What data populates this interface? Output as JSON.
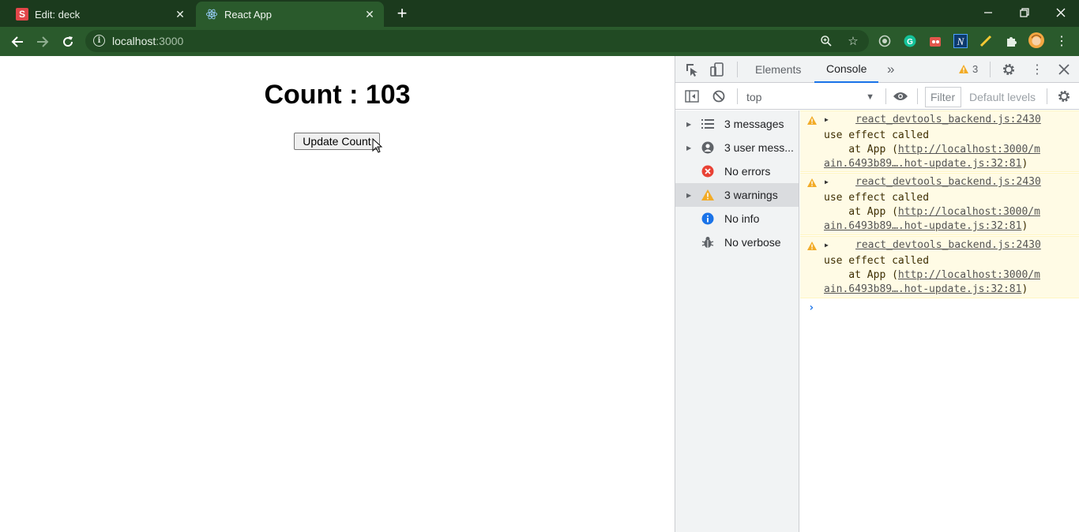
{
  "browser": {
    "tabs": [
      {
        "title": "Edit: deck",
        "favicon": "S"
      },
      {
        "title": "React App",
        "favicon": "react-icon"
      }
    ],
    "new_tab_label": "+",
    "url_host": "localhost",
    "url_port": ":3000",
    "window_controls": [
      "minimize-icon",
      "restore-icon",
      "close-icon"
    ]
  },
  "page": {
    "heading": "Count : 103",
    "button_label": "Update Count"
  },
  "devtools": {
    "tabs": [
      {
        "label": "Elements"
      },
      {
        "label": "Console"
      }
    ],
    "more_tabs": "»",
    "warning_count": "3",
    "context": "top",
    "filter_placeholder": "Filter",
    "levels_label": "Default levels",
    "sidebar": [
      {
        "label": "3 messages",
        "icon": "list-icon",
        "expandable": true
      },
      {
        "label": "3 user mess...",
        "icon": "user-icon",
        "expandable": true
      },
      {
        "label": "No errors",
        "icon": "error-icon",
        "expandable": false
      },
      {
        "label": "3 warnings",
        "icon": "warning-icon",
        "expandable": true,
        "selected": true
      },
      {
        "label": "No info",
        "icon": "info-icon",
        "expandable": false
      },
      {
        "label": "No verbose",
        "icon": "bug-icon",
        "expandable": false
      }
    ],
    "messages": [
      {
        "source": "react_devtools_backend.js:2430",
        "text": "use effect called",
        "at_prefix": "    at App (",
        "link_part1": "http://localhost:3000/m",
        "link_part2": "ain.6493b89….hot-update.js:32:81",
        "suffix": ")"
      },
      {
        "source": "react_devtools_backend.js:2430",
        "text": "use effect called",
        "at_prefix": "    at App (",
        "link_part1": "http://localhost:3000/m",
        "link_part2": "ain.6493b89….hot-update.js:32:81",
        "suffix": ")"
      },
      {
        "source": "react_devtools_backend.js:2430",
        "text": "use effect called",
        "at_prefix": "    at App (",
        "link_part1": "http://localhost:3000/m",
        "link_part2": "ain.6493b89….hot-update.js:32:81",
        "suffix": ")"
      }
    ],
    "prompt_symbol": "›"
  },
  "colors": {
    "tabstrip": "#1b3a1d",
    "toolbar": "#2a5a2c",
    "warning": "#f2ab26",
    "error": "#e94235",
    "info": "#1a73e8",
    "accent": "#1a73e8"
  }
}
